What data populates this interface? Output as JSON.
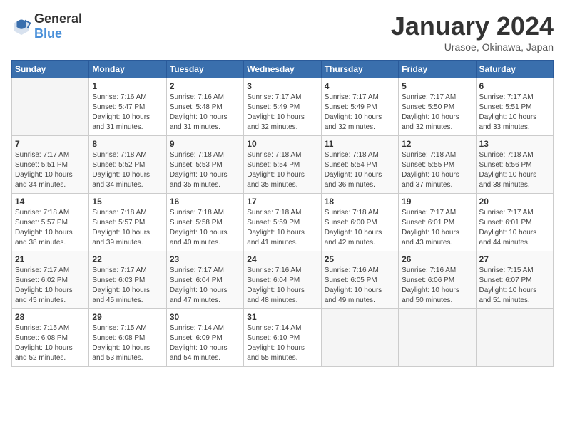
{
  "header": {
    "logo": {
      "text1": "General",
      "text2": "Blue"
    },
    "title": "January 2024",
    "subtitle": "Urasoe, Okinawa, Japan"
  },
  "weekdays": [
    "Sunday",
    "Monday",
    "Tuesday",
    "Wednesday",
    "Thursday",
    "Friday",
    "Saturday"
  ],
  "weeks": [
    [
      {
        "day": "",
        "info": ""
      },
      {
        "day": "1",
        "info": "Sunrise: 7:16 AM\nSunset: 5:47 PM\nDaylight: 10 hours\nand 31 minutes."
      },
      {
        "day": "2",
        "info": "Sunrise: 7:16 AM\nSunset: 5:48 PM\nDaylight: 10 hours\nand 31 minutes."
      },
      {
        "day": "3",
        "info": "Sunrise: 7:17 AM\nSunset: 5:49 PM\nDaylight: 10 hours\nand 32 minutes."
      },
      {
        "day": "4",
        "info": "Sunrise: 7:17 AM\nSunset: 5:49 PM\nDaylight: 10 hours\nand 32 minutes."
      },
      {
        "day": "5",
        "info": "Sunrise: 7:17 AM\nSunset: 5:50 PM\nDaylight: 10 hours\nand 32 minutes."
      },
      {
        "day": "6",
        "info": "Sunrise: 7:17 AM\nSunset: 5:51 PM\nDaylight: 10 hours\nand 33 minutes."
      }
    ],
    [
      {
        "day": "7",
        "info": "Sunrise: 7:17 AM\nSunset: 5:51 PM\nDaylight: 10 hours\nand 34 minutes."
      },
      {
        "day": "8",
        "info": "Sunrise: 7:18 AM\nSunset: 5:52 PM\nDaylight: 10 hours\nand 34 minutes."
      },
      {
        "day": "9",
        "info": "Sunrise: 7:18 AM\nSunset: 5:53 PM\nDaylight: 10 hours\nand 35 minutes."
      },
      {
        "day": "10",
        "info": "Sunrise: 7:18 AM\nSunset: 5:54 PM\nDaylight: 10 hours\nand 35 minutes."
      },
      {
        "day": "11",
        "info": "Sunrise: 7:18 AM\nSunset: 5:54 PM\nDaylight: 10 hours\nand 36 minutes."
      },
      {
        "day": "12",
        "info": "Sunrise: 7:18 AM\nSunset: 5:55 PM\nDaylight: 10 hours\nand 37 minutes."
      },
      {
        "day": "13",
        "info": "Sunrise: 7:18 AM\nSunset: 5:56 PM\nDaylight: 10 hours\nand 38 minutes."
      }
    ],
    [
      {
        "day": "14",
        "info": "Sunrise: 7:18 AM\nSunset: 5:57 PM\nDaylight: 10 hours\nand 38 minutes."
      },
      {
        "day": "15",
        "info": "Sunrise: 7:18 AM\nSunset: 5:57 PM\nDaylight: 10 hours\nand 39 minutes."
      },
      {
        "day": "16",
        "info": "Sunrise: 7:18 AM\nSunset: 5:58 PM\nDaylight: 10 hours\nand 40 minutes."
      },
      {
        "day": "17",
        "info": "Sunrise: 7:18 AM\nSunset: 5:59 PM\nDaylight: 10 hours\nand 41 minutes."
      },
      {
        "day": "18",
        "info": "Sunrise: 7:18 AM\nSunset: 6:00 PM\nDaylight: 10 hours\nand 42 minutes."
      },
      {
        "day": "19",
        "info": "Sunrise: 7:17 AM\nSunset: 6:01 PM\nDaylight: 10 hours\nand 43 minutes."
      },
      {
        "day": "20",
        "info": "Sunrise: 7:17 AM\nSunset: 6:01 PM\nDaylight: 10 hours\nand 44 minutes."
      }
    ],
    [
      {
        "day": "21",
        "info": "Sunrise: 7:17 AM\nSunset: 6:02 PM\nDaylight: 10 hours\nand 45 minutes."
      },
      {
        "day": "22",
        "info": "Sunrise: 7:17 AM\nSunset: 6:03 PM\nDaylight: 10 hours\nand 45 minutes."
      },
      {
        "day": "23",
        "info": "Sunrise: 7:17 AM\nSunset: 6:04 PM\nDaylight: 10 hours\nand 47 minutes."
      },
      {
        "day": "24",
        "info": "Sunrise: 7:16 AM\nSunset: 6:04 PM\nDaylight: 10 hours\nand 48 minutes."
      },
      {
        "day": "25",
        "info": "Sunrise: 7:16 AM\nSunset: 6:05 PM\nDaylight: 10 hours\nand 49 minutes."
      },
      {
        "day": "26",
        "info": "Sunrise: 7:16 AM\nSunset: 6:06 PM\nDaylight: 10 hours\nand 50 minutes."
      },
      {
        "day": "27",
        "info": "Sunrise: 7:15 AM\nSunset: 6:07 PM\nDaylight: 10 hours\nand 51 minutes."
      }
    ],
    [
      {
        "day": "28",
        "info": "Sunrise: 7:15 AM\nSunset: 6:08 PM\nDaylight: 10 hours\nand 52 minutes."
      },
      {
        "day": "29",
        "info": "Sunrise: 7:15 AM\nSunset: 6:08 PM\nDaylight: 10 hours\nand 53 minutes."
      },
      {
        "day": "30",
        "info": "Sunrise: 7:14 AM\nSunset: 6:09 PM\nDaylight: 10 hours\nand 54 minutes."
      },
      {
        "day": "31",
        "info": "Sunrise: 7:14 AM\nSunset: 6:10 PM\nDaylight: 10 hours\nand 55 minutes."
      },
      {
        "day": "",
        "info": ""
      },
      {
        "day": "",
        "info": ""
      },
      {
        "day": "",
        "info": ""
      }
    ]
  ]
}
